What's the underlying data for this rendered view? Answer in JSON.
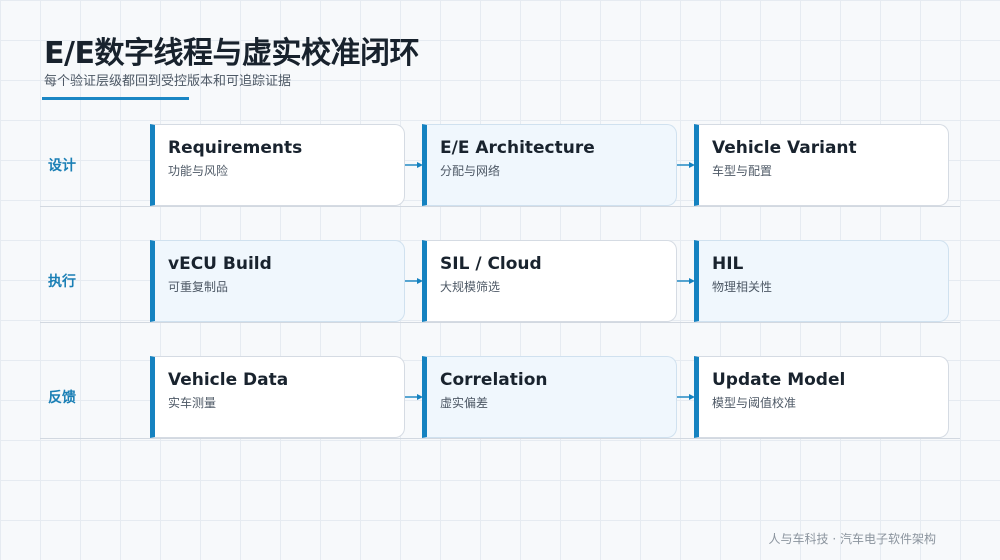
{
  "header": {
    "title": "E/E数字线程与虚实校准闭环",
    "subtitle": "每个验证层级都回到受控版本和可追踪证据"
  },
  "rows": [
    {
      "label": "设计",
      "cards": [
        {
          "title": "Requirements",
          "subtitle": "功能与风险"
        },
        {
          "title": "E/E Architecture",
          "subtitle": "分配与网络"
        },
        {
          "title": "Vehicle Variant",
          "subtitle": "车型与配置"
        }
      ]
    },
    {
      "label": "执行",
      "cards": [
        {
          "title": "vECU Build",
          "subtitle": "可重复制品"
        },
        {
          "title": "SIL / Cloud",
          "subtitle": "大规模筛选"
        },
        {
          "title": "HIL",
          "subtitle": "物理相关性"
        }
      ]
    },
    {
      "label": "反馈",
      "cards": [
        {
          "title": "Vehicle Data",
          "subtitle": "实车测量"
        },
        {
          "title": "Correlation",
          "subtitle": "虚实偏差"
        },
        {
          "title": "Update Model",
          "subtitle": "模型与阈值校准"
        }
      ]
    }
  ],
  "footer": {
    "text": "人与车科技 · 汽车电子软件架构"
  },
  "colors": {
    "accent": "#1582c0",
    "label": "#1a7fb5",
    "tint": "#f0f7fd"
  }
}
